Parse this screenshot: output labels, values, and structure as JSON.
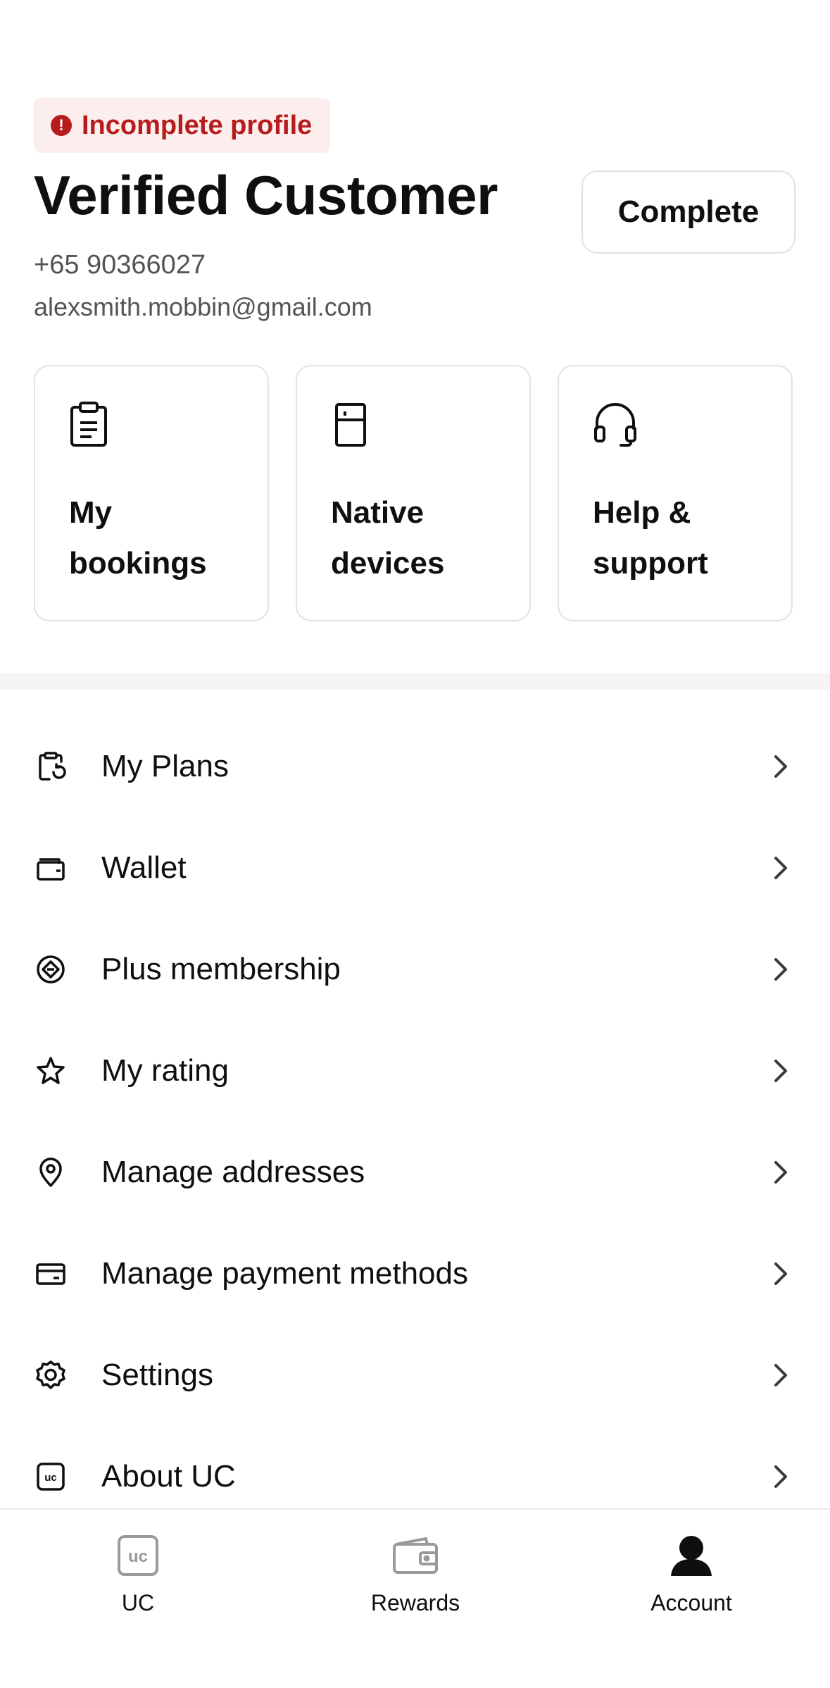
{
  "profile": {
    "badge_text": "Incomplete profile",
    "badge_icon": "exclamation-icon",
    "badge_icon_glyph": "!",
    "name": "Verified Customer",
    "phone": "+65 90366027",
    "email": "alexsmith.mobbin@gmail.com",
    "complete_label": "Complete"
  },
  "cards": [
    {
      "label": "My bookings",
      "icon": "clipboard-icon"
    },
    {
      "label": "Native devices",
      "icon": "device-icon"
    },
    {
      "label": "Help & support",
      "icon": "headphones-icon"
    }
  ],
  "menu": [
    {
      "label": "My Plans",
      "icon": "plan-icon"
    },
    {
      "label": "Wallet",
      "icon": "wallet-icon"
    },
    {
      "label": "Plus membership",
      "icon": "membership-icon"
    },
    {
      "label": "My rating",
      "icon": "star-icon"
    },
    {
      "label": "Manage addresses",
      "icon": "location-pin-icon"
    },
    {
      "label": "Manage payment methods",
      "icon": "card-icon"
    },
    {
      "label": "Settings",
      "icon": "gear-icon"
    },
    {
      "label": "About UC",
      "icon": "uc-logo-icon"
    }
  ],
  "bottom_nav": [
    {
      "label": "UC",
      "icon": "uc-logo-icon",
      "active": false
    },
    {
      "label": "Rewards",
      "icon": "rewards-wallet-icon",
      "active": false
    },
    {
      "label": "Account",
      "icon": "account-icon",
      "active": true
    }
  ],
  "colors": {
    "alert": "#b71c1c",
    "alert_bg": "#fdeeee",
    "text": "#0f0f0f",
    "muted": "#545454",
    "border": "#e2e2e2"
  }
}
